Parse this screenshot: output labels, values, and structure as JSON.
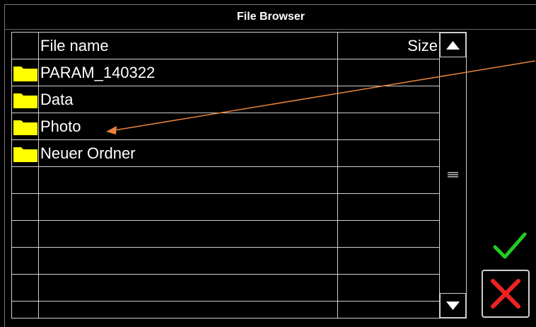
{
  "window": {
    "title": "File Browser"
  },
  "table": {
    "columns": {
      "name": "File name",
      "size": "Size"
    },
    "rows": [
      {
        "name": "PARAM_140322",
        "size": "",
        "icon": "folder-icon"
      },
      {
        "name": "Data",
        "size": "",
        "icon": "folder-icon"
      },
      {
        "name": "Photo",
        "size": "",
        "icon": "folder-icon"
      },
      {
        "name": "Neuer Ordner",
        "size": "",
        "icon": "folder-icon"
      },
      {
        "name": "",
        "size": ""
      },
      {
        "name": "",
        "size": ""
      },
      {
        "name": "",
        "size": ""
      },
      {
        "name": "",
        "size": ""
      },
      {
        "name": "",
        "size": ""
      }
    ]
  },
  "scrollbar": {
    "up_icon": "triangle-up-icon",
    "down_icon": "triangle-down-icon",
    "grip_icon": "grip-icon"
  },
  "actions": {
    "ok_icon": "checkmark-icon",
    "cancel_icon": "x-icon"
  },
  "colors": {
    "folder": "#ffff00",
    "ok": "#22cc22",
    "cancel": "#ee2222",
    "annotation": "#e8823a"
  }
}
